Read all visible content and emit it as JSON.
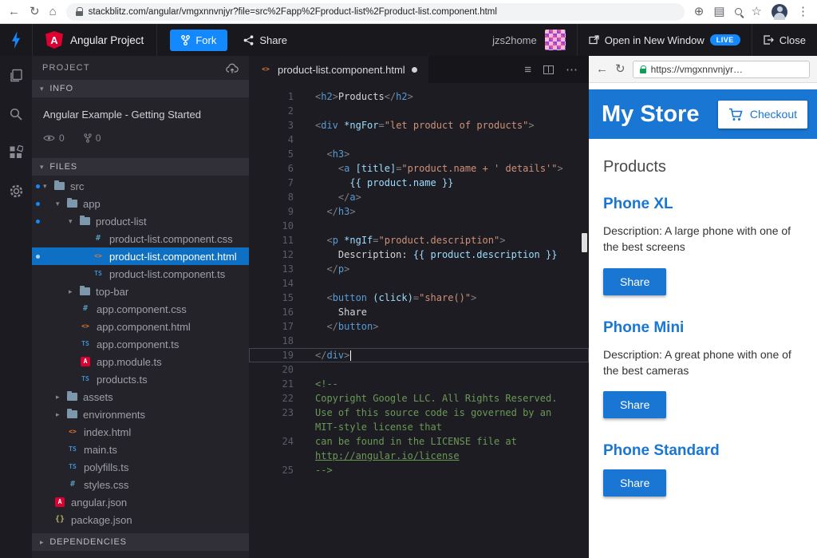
{
  "browser": {
    "url": "stackblitz.com/angular/vmgxnnvnjyr?file=src%2Fapp%2Fproduct-list%2Fproduct-list.component.html"
  },
  "icons": {
    "back": "←",
    "reload": "↻",
    "home": "⌂",
    "add_circle": "⊕",
    "translate": "▤",
    "star": "☆",
    "menu_dots": "⋮",
    "tab_menu": "≡",
    "tab_more": "⋯",
    "folder_open": "▾",
    "folder_closed": "▸",
    "deps_chevron": "▸",
    "section_chevron": "▾",
    "file_css": "#",
    "file_html": "<>",
    "file_ts": "TS",
    "file_ng": "A",
    "file_json": "{}"
  },
  "header": {
    "brand": "Angular Project",
    "fork": "Fork",
    "share": "Share",
    "username": "jzs2home",
    "open_window": "Open in New Window",
    "live": "LIVE",
    "close": "Close"
  },
  "sidebar": {
    "project": "PROJECT",
    "info_header": "INFO",
    "files_header": "FILES",
    "deps_header": "DEPENDENCIES",
    "info_title": "Angular Example - Getting Started",
    "views": "0",
    "forks": "0",
    "tree": [
      {
        "label": "src",
        "type": "folder",
        "level": 0,
        "open": true,
        "dot": true
      },
      {
        "label": "app",
        "type": "folder",
        "level": 1,
        "open": true,
        "dot": true
      },
      {
        "label": "product-list",
        "type": "folder",
        "level": 2,
        "open": true,
        "dot": true
      },
      {
        "label": "product-list.component.css",
        "type": "css",
        "level": 3
      },
      {
        "label": "product-list.component.html",
        "type": "html",
        "level": 3,
        "selected": true,
        "dot": true
      },
      {
        "label": "product-list.component.ts",
        "type": "ts",
        "level": 3
      },
      {
        "label": "top-bar",
        "type": "folder",
        "level": 2,
        "open": false
      },
      {
        "label": "app.component.css",
        "type": "css",
        "level": 2
      },
      {
        "label": "app.component.html",
        "type": "html",
        "level": 2
      },
      {
        "label": "app.component.ts",
        "type": "ts",
        "level": 2
      },
      {
        "label": "app.module.ts",
        "type": "ng",
        "level": 2
      },
      {
        "label": "products.ts",
        "type": "ts",
        "level": 2
      },
      {
        "label": "assets",
        "type": "folder",
        "level": 1,
        "open": false
      },
      {
        "label": "environments",
        "type": "folder",
        "level": 1,
        "open": false
      },
      {
        "label": "index.html",
        "type": "html",
        "level": 1
      },
      {
        "label": "main.ts",
        "type": "ts",
        "level": 1
      },
      {
        "label": "polyfills.ts",
        "type": "ts",
        "level": 1
      },
      {
        "label": "styles.css",
        "type": "css",
        "level": 1
      },
      {
        "label": "angular.json",
        "type": "ng",
        "level": 0
      },
      {
        "label": "package.json",
        "type": "json",
        "level": 0
      }
    ]
  },
  "editor": {
    "tab": "product-list.component.html",
    "rows": [
      {
        "n": "1",
        "t": [
          [
            "p",
            "<"
          ],
          [
            "t",
            "h2"
          ],
          [
            "p",
            ">"
          ],
          [
            "x",
            "Products"
          ],
          [
            "p",
            "</"
          ],
          [
            "t",
            "h2"
          ],
          [
            "p",
            ">"
          ]
        ]
      },
      {
        "n": "2",
        "t": []
      },
      {
        "n": "3",
        "t": [
          [
            "p",
            "<"
          ],
          [
            "t",
            "div"
          ],
          [
            "x",
            " "
          ],
          [
            "a",
            "*ngFor"
          ],
          [
            "p",
            "="
          ],
          [
            "s",
            "\"let product of products\""
          ],
          [
            "p",
            ">"
          ]
        ]
      },
      {
        "n": "4",
        "t": []
      },
      {
        "n": "5",
        "t": [
          [
            "x",
            "  "
          ],
          [
            "p",
            "<"
          ],
          [
            "t",
            "h3"
          ],
          [
            "p",
            ">"
          ]
        ]
      },
      {
        "n": "6",
        "t": [
          [
            "x",
            "    "
          ],
          [
            "p",
            "<"
          ],
          [
            "t",
            "a"
          ],
          [
            "x",
            " "
          ],
          [
            "a",
            "[title]"
          ],
          [
            "p",
            "="
          ],
          [
            "s",
            "\"product.name + ' details'\""
          ],
          [
            "p",
            ">"
          ]
        ]
      },
      {
        "n": "7",
        "t": [
          [
            "x",
            "      "
          ],
          [
            "i",
            "{{ product.name }}"
          ]
        ]
      },
      {
        "n": "8",
        "t": [
          [
            "x",
            "    "
          ],
          [
            "p",
            "</"
          ],
          [
            "t",
            "a"
          ],
          [
            "p",
            ">"
          ]
        ]
      },
      {
        "n": "9",
        "t": [
          [
            "x",
            "  "
          ],
          [
            "p",
            "</"
          ],
          [
            "t",
            "h3"
          ],
          [
            "p",
            ">"
          ]
        ]
      },
      {
        "n": "10",
        "t": []
      },
      {
        "n": "11",
        "t": [
          [
            "x",
            "  "
          ],
          [
            "p",
            "<"
          ],
          [
            "t",
            "p"
          ],
          [
            "x",
            " "
          ],
          [
            "a",
            "*ngIf"
          ],
          [
            "p",
            "="
          ],
          [
            "s",
            "\"product.description\""
          ],
          [
            "p",
            ">"
          ]
        ]
      },
      {
        "n": "12",
        "t": [
          [
            "x",
            "    Description: "
          ],
          [
            "i",
            "{{ product.description }}"
          ]
        ]
      },
      {
        "n": "13",
        "t": [
          [
            "x",
            "  "
          ],
          [
            "p",
            "</"
          ],
          [
            "t",
            "p"
          ],
          [
            "p",
            ">"
          ]
        ]
      },
      {
        "n": "14",
        "t": []
      },
      {
        "n": "15",
        "t": [
          [
            "x",
            "  "
          ],
          [
            "p",
            "<"
          ],
          [
            "t",
            "button"
          ],
          [
            "x",
            " "
          ],
          [
            "a",
            "(click)"
          ],
          [
            "p",
            "="
          ],
          [
            "s",
            "\"share()\""
          ],
          [
            "p",
            ">"
          ]
        ]
      },
      {
        "n": "16",
        "t": [
          [
            "x",
            "    Share"
          ]
        ]
      },
      {
        "n": "17",
        "t": [
          [
            "x",
            "  "
          ],
          [
            "p",
            "</"
          ],
          [
            "t",
            "button"
          ],
          [
            "p",
            ">"
          ]
        ]
      },
      {
        "n": "18",
        "t": []
      },
      {
        "n": "19",
        "active": true,
        "t": [
          [
            "p",
            "</"
          ],
          [
            "t",
            "div"
          ],
          [
            "p",
            ">"
          ]
        ]
      },
      {
        "n": "20",
        "t": []
      },
      {
        "n": "21",
        "t": [
          [
            "c",
            "<!--"
          ]
        ]
      },
      {
        "n": "22",
        "t": [
          [
            "c",
            "Copyright Google LLC. All Rights Reserved."
          ]
        ]
      },
      {
        "n": "23",
        "t": [
          [
            "c",
            "Use of this source code is governed by an"
          ]
        ]
      },
      {
        "n": "",
        "t": [
          [
            "c",
            "MIT-style license that"
          ]
        ]
      },
      {
        "n": "24",
        "t": [
          [
            "c",
            "can be found in the LICENSE file at"
          ]
        ]
      },
      {
        "n": "",
        "t": [
          [
            "l",
            "http://angular.io/license"
          ]
        ]
      },
      {
        "n": "25",
        "t": [
          [
            "c",
            "-->"
          ]
        ]
      }
    ]
  },
  "preview": {
    "url": "https://vmgxnnvnjyr…",
    "store_title": "My Store",
    "checkout": "Checkout",
    "products_heading": "Products",
    "products": [
      {
        "name": "Phone XL",
        "description": "Description: A large phone with one of the best screens",
        "share": "Share"
      },
      {
        "name": "Phone Mini",
        "description": "Description: A great phone with one of the best cameras",
        "share": "Share"
      },
      {
        "name": "Phone Standard",
        "description": "",
        "share": "Share"
      }
    ]
  },
  "colors": {
    "accent": "#1389fd",
    "angular_red": "#dd0031",
    "selected_file_bg": "#0d70c4",
    "preview_primary": "#1976d2"
  }
}
